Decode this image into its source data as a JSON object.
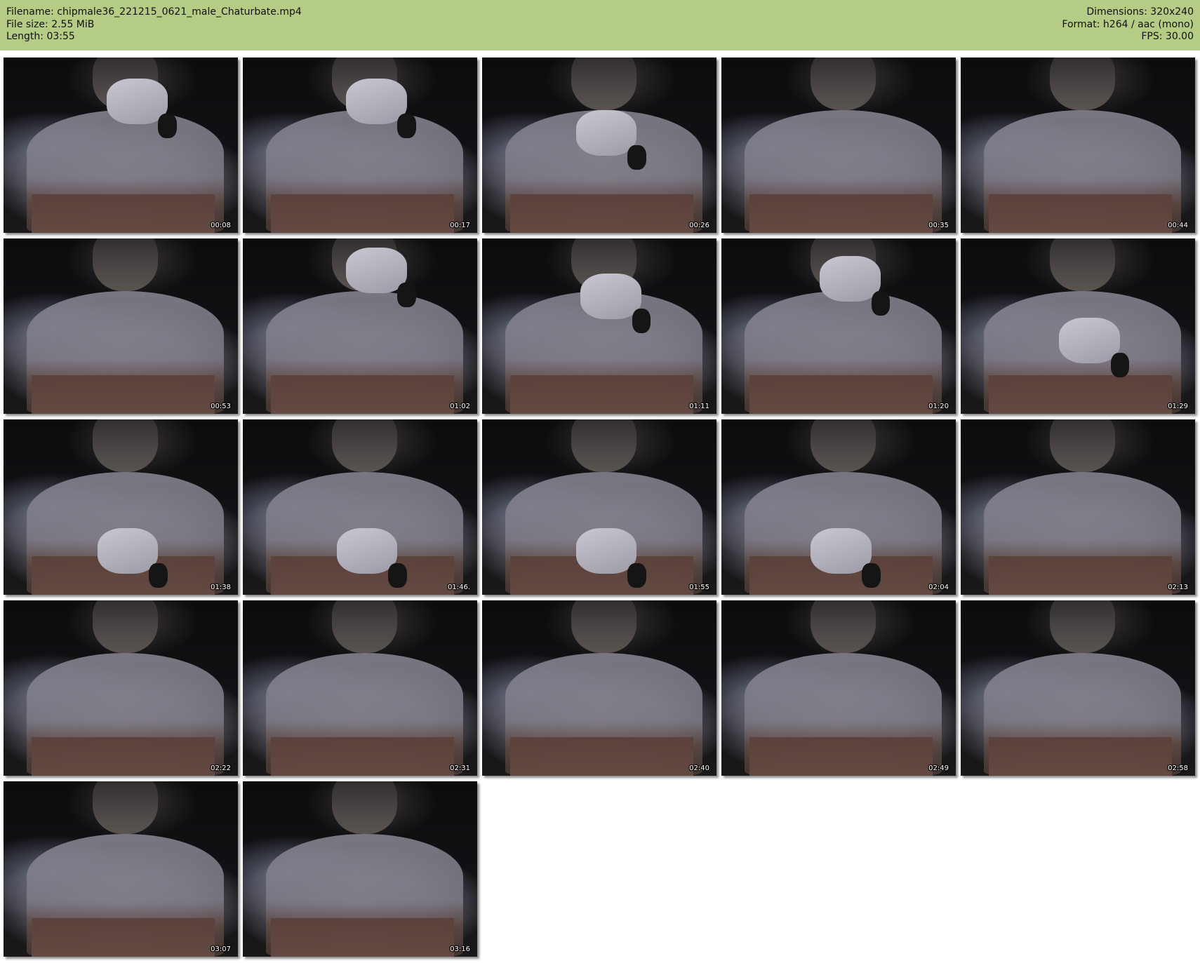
{
  "header": {
    "filename": "Filename: chipmale36_221215_0621_male_Chaturbate.mp4",
    "filesize": "File size: 2.55 MiB",
    "length": "Length: 03:55",
    "dimensions": "Dimensions: 320x240",
    "format": "Format: h264 / aac (mono)",
    "fps": "FPS: 30.00"
  },
  "frames": [
    {
      "timestamp": "00:08"
    },
    {
      "timestamp": "00:17"
    },
    {
      "timestamp": "00:26"
    },
    {
      "timestamp": "00:35"
    },
    {
      "timestamp": "00:44"
    },
    {
      "timestamp": "00:53"
    },
    {
      "timestamp": "01:02"
    },
    {
      "timestamp": "01:11"
    },
    {
      "timestamp": "01:20"
    },
    {
      "timestamp": "01:29"
    },
    {
      "timestamp": "01:38"
    },
    {
      "timestamp": "01:46."
    },
    {
      "timestamp": "01:55"
    },
    {
      "timestamp": "02:04"
    },
    {
      "timestamp": "02:13"
    },
    {
      "timestamp": "02:22"
    },
    {
      "timestamp": "02:31"
    },
    {
      "timestamp": "02:40"
    },
    {
      "timestamp": "02:49"
    },
    {
      "timestamp": "02:58"
    },
    {
      "timestamp": "03:07"
    },
    {
      "timestamp": "03:16"
    }
  ],
  "colors": {
    "header_background": "#b4cc84",
    "page_background": "#ffffff",
    "timestamp_text": "#ffffff"
  }
}
